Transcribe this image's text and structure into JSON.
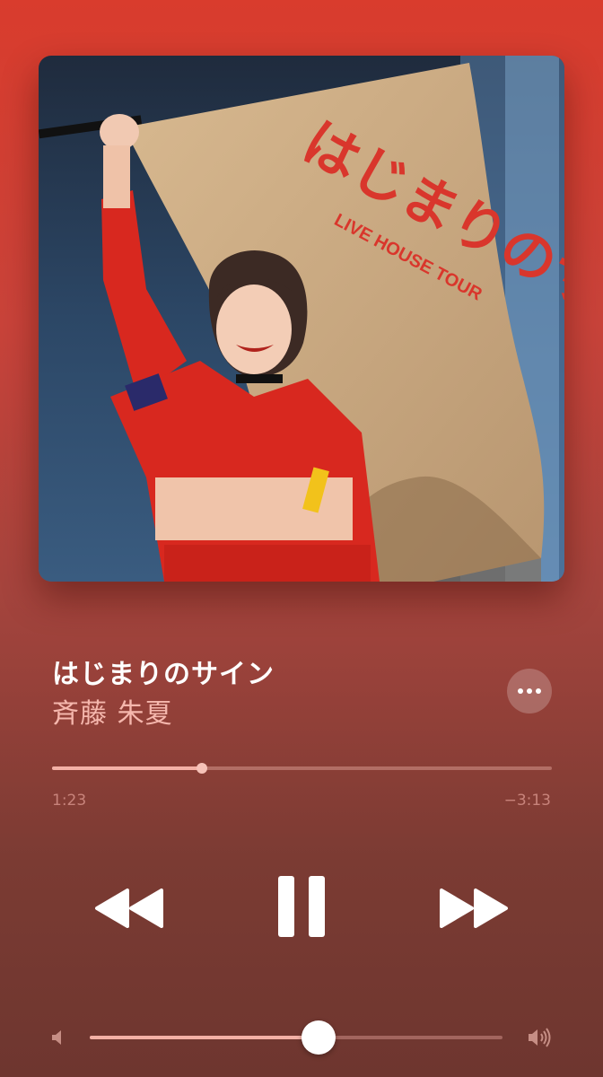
{
  "now_playing": {
    "title": "はじまりのサイン",
    "artist": "斉藤 朱夏",
    "artwork": {
      "flag_text": "はじまりのサイン",
      "flag_subtext": "LIVE HOUSE TOUR"
    }
  },
  "playback": {
    "elapsed": "1:23",
    "remaining": "−3:13",
    "progress": 0.3
  },
  "volume": {
    "level": 0.555
  },
  "icons": {
    "more": "more-icon",
    "rewind": "rewind-icon",
    "pause": "pause-icon",
    "forward": "forward-icon",
    "volume_low": "volume-low-icon",
    "volume_high": "volume-high-icon"
  },
  "colors": {
    "background_top": "#d93c2d",
    "background_bottom": "#6e362f",
    "artist_text": "#f5b7ad",
    "progress_fill": "#f3b1a6"
  }
}
